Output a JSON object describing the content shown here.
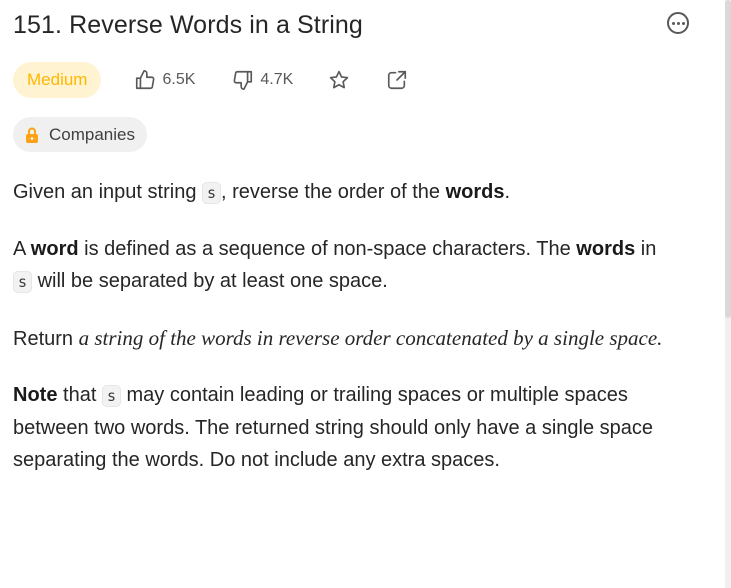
{
  "problem": {
    "title": "151. Reverse Words in a String",
    "difficulty": "Medium",
    "likes": "6.5K",
    "dislikes": "4.7K",
    "companies_label": "Companies"
  },
  "description": {
    "p1": {
      "a": "Given an input string ",
      "code": "s",
      "b": ", reverse the order of the ",
      "bold": "words",
      "c": "."
    },
    "p2": {
      "a": "A ",
      "bold1": "word",
      "b": " is defined as a sequence of non-space characters. The ",
      "bold2": "words",
      "c": " in",
      "code": "s",
      "d": " will be separated by at least one space."
    },
    "p3": {
      "a": "Return ",
      "italic": "a string of the words in reverse order concatenated by a single space."
    },
    "p4": {
      "bold": "Note",
      "a": " that ",
      "code": "s",
      "b": " may contain leading or trailing spaces or multiple spaces between two words. The returned string should only have a single space separating the words. Do not include any extra spaces."
    }
  },
  "colors": {
    "difficulty_bg": "#fff3d1",
    "difficulty_text": "#ffb800",
    "lock": "#ffa116"
  },
  "icons": {
    "like": "thumbs-up-icon",
    "dislike": "thumbs-down-icon",
    "star": "star-icon",
    "share": "share-icon",
    "lock": "lock-icon",
    "more": "more-icon"
  }
}
